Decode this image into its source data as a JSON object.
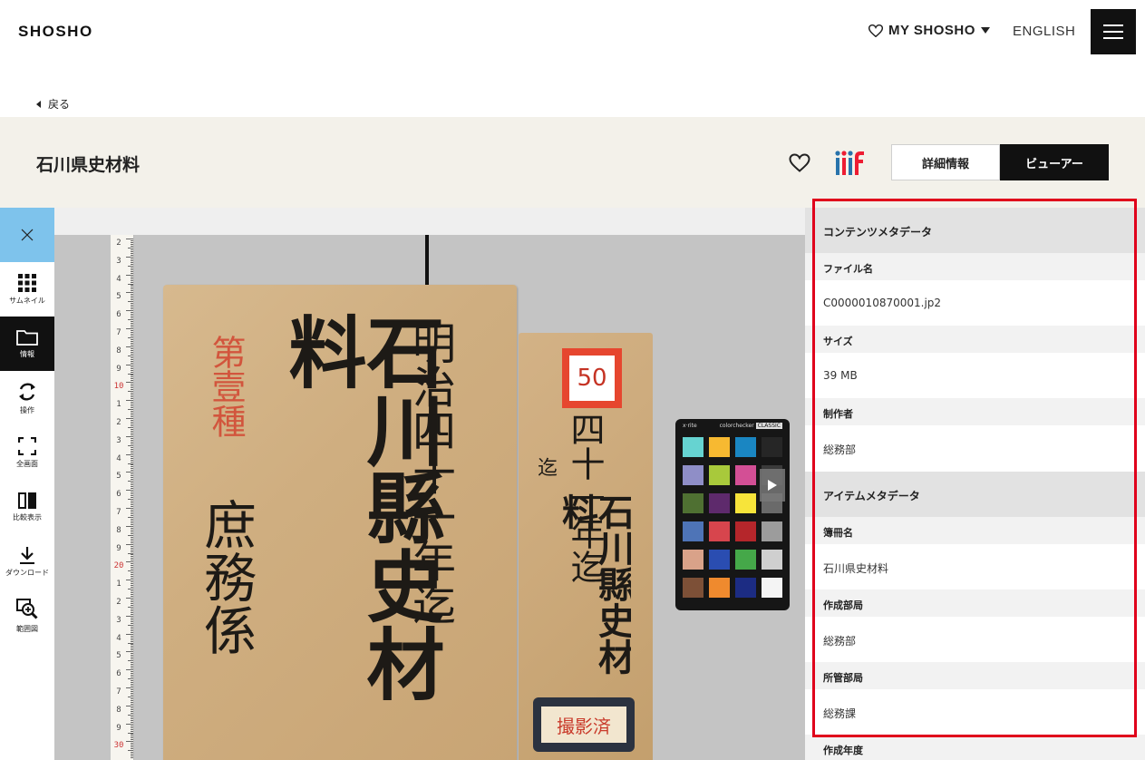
{
  "header": {
    "brand": "SHOSHO",
    "my_shosho": "MY SHOSHO",
    "language": "ENGLISH"
  },
  "back_label": "戻る",
  "title": "石川県史材料",
  "tabs": {
    "detail": "詳細情報",
    "viewer": "ビューアー"
  },
  "toolbar": {
    "thumbnail": "サムネイル",
    "info": "情報",
    "operation": "操作",
    "fullscreen": "全画面",
    "compare": "比較表示",
    "download": "ダウンロード",
    "zoom_region": "範囲図"
  },
  "image_text": {
    "book_title": "石川縣史材料",
    "era": "明治四十一年迄",
    "office": "庶務係",
    "class_mark": "第壹種",
    "side_title": "石川縣史材料",
    "side_era": "四十一年迄",
    "side_prefix": "迄",
    "number_label": "50",
    "stamp": "撮影済",
    "checker_brand": "x·rite",
    "checker_name": "colorchecker",
    "checker_edition": "CLASSIC",
    "ruler_numbers": [
      "2",
      "3",
      "4",
      "5",
      "6",
      "7",
      "8",
      "9",
      "10",
      "1",
      "2",
      "3",
      "4",
      "5",
      "6",
      "7",
      "8",
      "9",
      "20",
      "1",
      "2",
      "3",
      "4",
      "5",
      "6",
      "7",
      "8",
      "9",
      "30"
    ]
  },
  "colorchecker_colors": [
    "#66d3d1",
    "#f7b931",
    "#1a86c2",
    "#262626",
    "#8f8ec7",
    "#a8c93b",
    "#d34f95",
    "#3a3a3a",
    "#4f7032",
    "#5e2a6c",
    "#f7e43a",
    "#6a6a6a",
    "#4e74b7",
    "#d7454d",
    "#b5262b",
    "#9c9c9c",
    "#d9a289",
    "#2a4db1",
    "#45a849",
    "#cfcfcf",
    "#7d5037",
    "#ef8a2e",
    "#1c2c83",
    "#f4f4f4"
  ],
  "metadata": {
    "content_section": "コンテンツメタデータ",
    "item_section": "アイテムメタデータ",
    "content_fields": [
      {
        "label": "ファイル名",
        "value": "C0000010870001.jp2"
      },
      {
        "label": "サイズ",
        "value": "39 MB"
      },
      {
        "label": "制作者",
        "value": "総務部"
      }
    ],
    "item_fields": [
      {
        "label": "簿冊名",
        "value": "石川県史材料"
      },
      {
        "label": "作成部局",
        "value": "総務部"
      },
      {
        "label": "所管部局",
        "value": "総務課"
      }
    ],
    "next_field_label": "作成年度"
  },
  "colors": {
    "accent_blue": "#7ec3ec",
    "highlight_red": "#e0001b",
    "title_band": "#f3f1ea"
  }
}
